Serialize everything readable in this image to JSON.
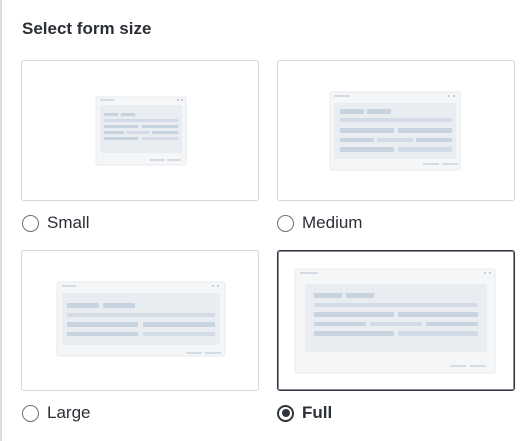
{
  "title": "Select form size",
  "options": [
    {
      "label": "Small",
      "selected": false
    },
    {
      "label": "Medium",
      "selected": false
    },
    {
      "label": "Large",
      "selected": false
    },
    {
      "label": "Full",
      "selected": true
    }
  ],
  "colors": {
    "selected_border": "#2f343b",
    "card_border": "#d4d8de",
    "preview_window": "#f5f6f8",
    "preview_panel": "#e9ecf0",
    "preview_bar": "#c8d3e0"
  }
}
